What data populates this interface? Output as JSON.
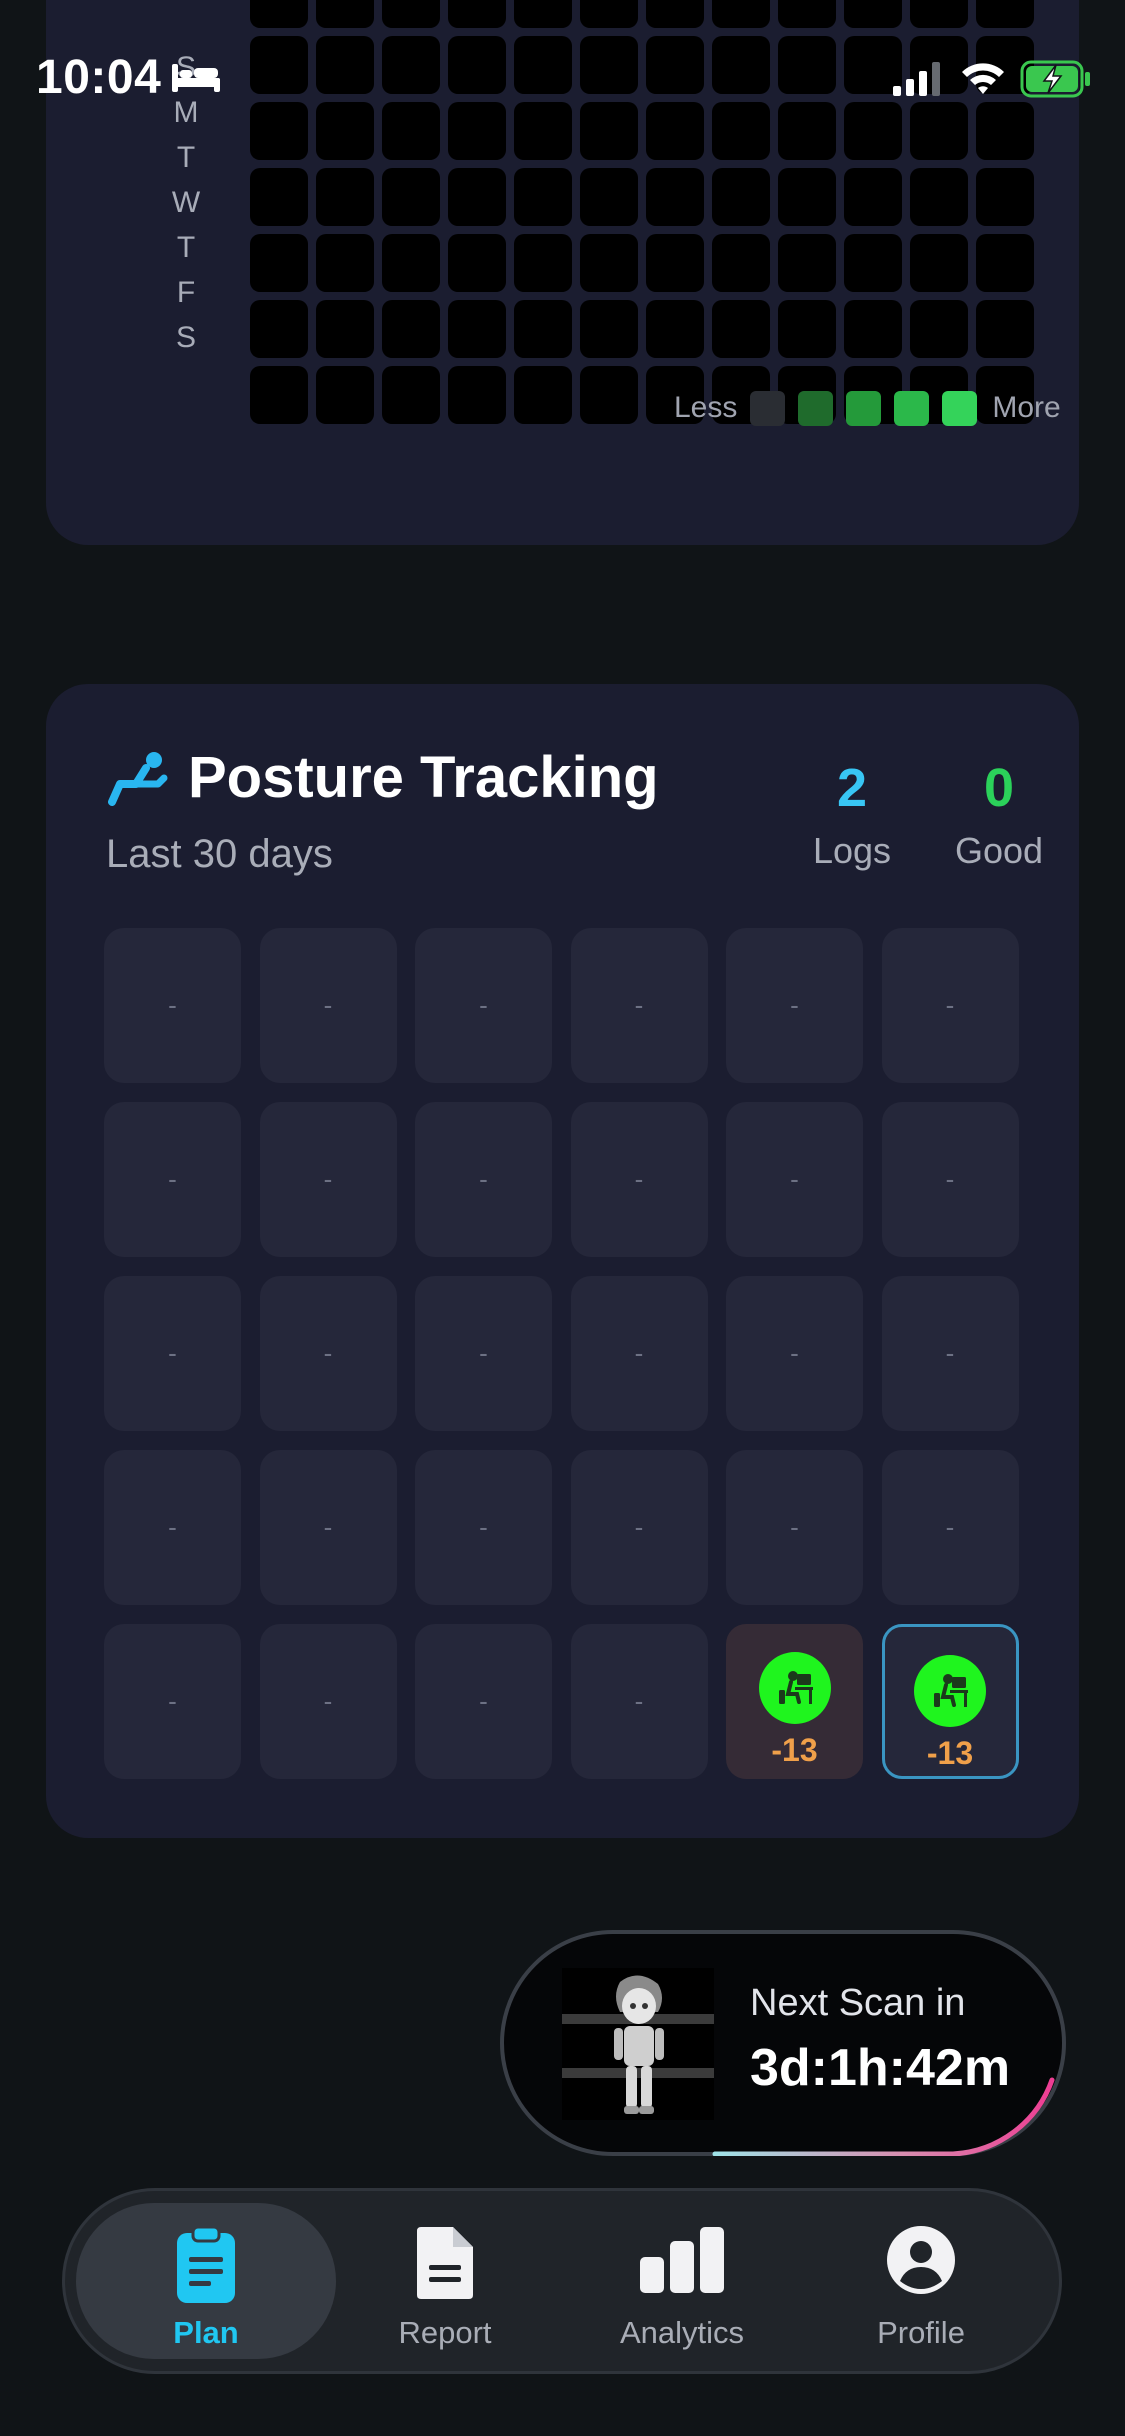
{
  "status_bar": {
    "time": "10:04"
  },
  "activity_heatmap": {
    "day_labels": [
      "S",
      "M",
      "T",
      "W",
      "T",
      "F",
      "S"
    ],
    "legend": {
      "less_label": "Less",
      "more_label": "More"
    },
    "colors": {
      "cell": "#000000",
      "scale": [
        "#2a2d33",
        "#1f6b2c",
        "#249a3a",
        "#2bb84a",
        "#34d35a"
      ]
    }
  },
  "posture": {
    "title": "Posture Tracking",
    "subtitle": "Last 30 days",
    "stats": {
      "logs_value": "2",
      "logs_label": "Logs",
      "good_value": "0",
      "good_label": "Good"
    },
    "empty_tile": "-",
    "tiles": [
      "-",
      "-",
      "-",
      "-",
      "-",
      "-",
      "-",
      "-",
      "-",
      "-",
      "-",
      "-",
      "-",
      "-",
      "-",
      "-",
      "-",
      "-",
      "-",
      "-",
      "-",
      "-",
      "-",
      "-",
      "-",
      "-",
      "-",
      "-"
    ],
    "logged": [
      {
        "score": "-13",
        "icon": "desk-posture-icon",
        "selected": false
      },
      {
        "score": "-13",
        "icon": "desk-posture-icon",
        "selected": true
      }
    ]
  },
  "next_scan": {
    "label": "Next Scan in",
    "countdown": "3d:1h:42m"
  },
  "tabbar": {
    "tabs": [
      {
        "label": "Plan",
        "icon": "clipboard-icon",
        "active": true
      },
      {
        "label": "Report",
        "icon": "document-icon",
        "active": false
      },
      {
        "label": "Analytics",
        "icon": "bar-chart-icon",
        "active": false
      },
      {
        "label": "Profile",
        "icon": "person-icon",
        "active": false
      }
    ]
  },
  "colors": {
    "accent": "#20c7f2",
    "good": "#2bd15a",
    "score": "#f0a04a",
    "badge": "#1ff51e"
  }
}
